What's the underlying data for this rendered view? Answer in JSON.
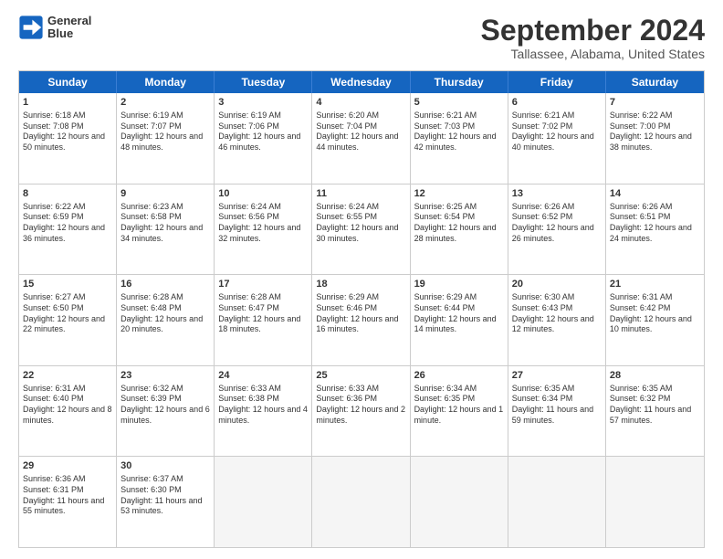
{
  "header": {
    "logo_line1": "General",
    "logo_line2": "Blue",
    "title": "September 2024",
    "subtitle": "Tallassee, Alabama, United States"
  },
  "weekdays": [
    "Sunday",
    "Monday",
    "Tuesday",
    "Wednesday",
    "Thursday",
    "Friday",
    "Saturday"
  ],
  "weeks": [
    [
      {
        "day": "1",
        "sunrise": "Sunrise: 6:18 AM",
        "sunset": "Sunset: 7:08 PM",
        "daylight": "Daylight: 12 hours and 50 minutes."
      },
      {
        "day": "2",
        "sunrise": "Sunrise: 6:19 AM",
        "sunset": "Sunset: 7:07 PM",
        "daylight": "Daylight: 12 hours and 48 minutes."
      },
      {
        "day": "3",
        "sunrise": "Sunrise: 6:19 AM",
        "sunset": "Sunset: 7:06 PM",
        "daylight": "Daylight: 12 hours and 46 minutes."
      },
      {
        "day": "4",
        "sunrise": "Sunrise: 6:20 AM",
        "sunset": "Sunset: 7:04 PM",
        "daylight": "Daylight: 12 hours and 44 minutes."
      },
      {
        "day": "5",
        "sunrise": "Sunrise: 6:21 AM",
        "sunset": "Sunset: 7:03 PM",
        "daylight": "Daylight: 12 hours and 42 minutes."
      },
      {
        "day": "6",
        "sunrise": "Sunrise: 6:21 AM",
        "sunset": "Sunset: 7:02 PM",
        "daylight": "Daylight: 12 hours and 40 minutes."
      },
      {
        "day": "7",
        "sunrise": "Sunrise: 6:22 AM",
        "sunset": "Sunset: 7:00 PM",
        "daylight": "Daylight: 12 hours and 38 minutes."
      }
    ],
    [
      {
        "day": "8",
        "sunrise": "Sunrise: 6:22 AM",
        "sunset": "Sunset: 6:59 PM",
        "daylight": "Daylight: 12 hours and 36 minutes."
      },
      {
        "day": "9",
        "sunrise": "Sunrise: 6:23 AM",
        "sunset": "Sunset: 6:58 PM",
        "daylight": "Daylight: 12 hours and 34 minutes."
      },
      {
        "day": "10",
        "sunrise": "Sunrise: 6:24 AM",
        "sunset": "Sunset: 6:56 PM",
        "daylight": "Daylight: 12 hours and 32 minutes."
      },
      {
        "day": "11",
        "sunrise": "Sunrise: 6:24 AM",
        "sunset": "Sunset: 6:55 PM",
        "daylight": "Daylight: 12 hours and 30 minutes."
      },
      {
        "day": "12",
        "sunrise": "Sunrise: 6:25 AM",
        "sunset": "Sunset: 6:54 PM",
        "daylight": "Daylight: 12 hours and 28 minutes."
      },
      {
        "day": "13",
        "sunrise": "Sunrise: 6:26 AM",
        "sunset": "Sunset: 6:52 PM",
        "daylight": "Daylight: 12 hours and 26 minutes."
      },
      {
        "day": "14",
        "sunrise": "Sunrise: 6:26 AM",
        "sunset": "Sunset: 6:51 PM",
        "daylight": "Daylight: 12 hours and 24 minutes."
      }
    ],
    [
      {
        "day": "15",
        "sunrise": "Sunrise: 6:27 AM",
        "sunset": "Sunset: 6:50 PM",
        "daylight": "Daylight: 12 hours and 22 minutes."
      },
      {
        "day": "16",
        "sunrise": "Sunrise: 6:28 AM",
        "sunset": "Sunset: 6:48 PM",
        "daylight": "Daylight: 12 hours and 20 minutes."
      },
      {
        "day": "17",
        "sunrise": "Sunrise: 6:28 AM",
        "sunset": "Sunset: 6:47 PM",
        "daylight": "Daylight: 12 hours and 18 minutes."
      },
      {
        "day": "18",
        "sunrise": "Sunrise: 6:29 AM",
        "sunset": "Sunset: 6:46 PM",
        "daylight": "Daylight: 12 hours and 16 minutes."
      },
      {
        "day": "19",
        "sunrise": "Sunrise: 6:29 AM",
        "sunset": "Sunset: 6:44 PM",
        "daylight": "Daylight: 12 hours and 14 minutes."
      },
      {
        "day": "20",
        "sunrise": "Sunrise: 6:30 AM",
        "sunset": "Sunset: 6:43 PM",
        "daylight": "Daylight: 12 hours and 12 minutes."
      },
      {
        "day": "21",
        "sunrise": "Sunrise: 6:31 AM",
        "sunset": "Sunset: 6:42 PM",
        "daylight": "Daylight: 12 hours and 10 minutes."
      }
    ],
    [
      {
        "day": "22",
        "sunrise": "Sunrise: 6:31 AM",
        "sunset": "Sunset: 6:40 PM",
        "daylight": "Daylight: 12 hours and 8 minutes."
      },
      {
        "day": "23",
        "sunrise": "Sunrise: 6:32 AM",
        "sunset": "Sunset: 6:39 PM",
        "daylight": "Daylight: 12 hours and 6 minutes."
      },
      {
        "day": "24",
        "sunrise": "Sunrise: 6:33 AM",
        "sunset": "Sunset: 6:38 PM",
        "daylight": "Daylight: 12 hours and 4 minutes."
      },
      {
        "day": "25",
        "sunrise": "Sunrise: 6:33 AM",
        "sunset": "Sunset: 6:36 PM",
        "daylight": "Daylight: 12 hours and 2 minutes."
      },
      {
        "day": "26",
        "sunrise": "Sunrise: 6:34 AM",
        "sunset": "Sunset: 6:35 PM",
        "daylight": "Daylight: 12 hours and 1 minute."
      },
      {
        "day": "27",
        "sunrise": "Sunrise: 6:35 AM",
        "sunset": "Sunset: 6:34 PM",
        "daylight": "Daylight: 11 hours and 59 minutes."
      },
      {
        "day": "28",
        "sunrise": "Sunrise: 6:35 AM",
        "sunset": "Sunset: 6:32 PM",
        "daylight": "Daylight: 11 hours and 57 minutes."
      }
    ],
    [
      {
        "day": "29",
        "sunrise": "Sunrise: 6:36 AM",
        "sunset": "Sunset: 6:31 PM",
        "daylight": "Daylight: 11 hours and 55 minutes."
      },
      {
        "day": "30",
        "sunrise": "Sunrise: 6:37 AM",
        "sunset": "Sunset: 6:30 PM",
        "daylight": "Daylight: 11 hours and 53 minutes."
      },
      {
        "day": "",
        "sunrise": "",
        "sunset": "",
        "daylight": ""
      },
      {
        "day": "",
        "sunrise": "",
        "sunset": "",
        "daylight": ""
      },
      {
        "day": "",
        "sunrise": "",
        "sunset": "",
        "daylight": ""
      },
      {
        "day": "",
        "sunrise": "",
        "sunset": "",
        "daylight": ""
      },
      {
        "day": "",
        "sunrise": "",
        "sunset": "",
        "daylight": ""
      }
    ]
  ]
}
